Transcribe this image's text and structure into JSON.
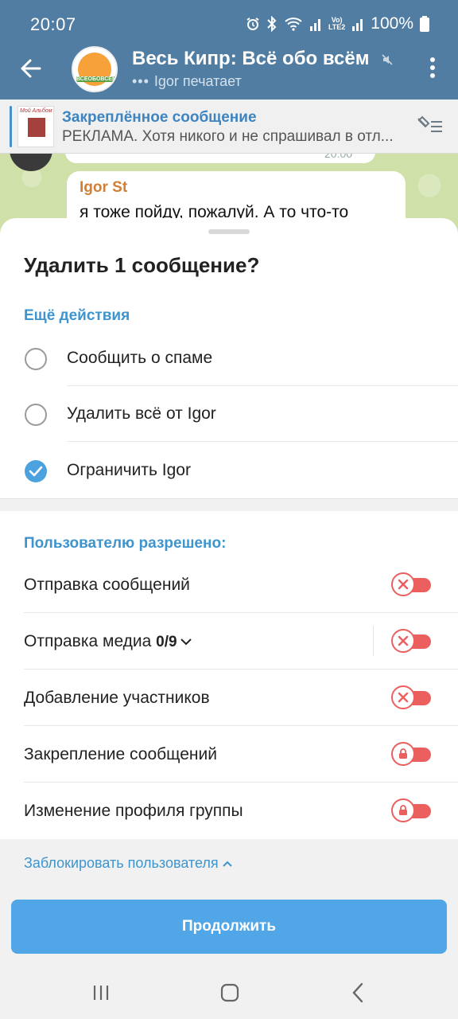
{
  "status": {
    "time": "20:07",
    "lte_top": "Vo)",
    "lte_bottom": "LTE2",
    "battery": "100%"
  },
  "chat_header": {
    "title": "Весь Кипр: Всё обо всём",
    "typing_dots": "•••",
    "subtitle": "Igor печатает",
    "avatar_tag": "ВСЕОБОВСЕМ"
  },
  "pinned": {
    "title": "Закреплённое сообщение",
    "text": "РЕКЛАМА.  Хотя никого и не спрашивал в отл...",
    "thumb_caption": "Мой Альбом"
  },
  "chat": {
    "prev_time": "20:00",
    "author": "Igor St",
    "message": "я тоже пойду, пожалуй. А то что-то"
  },
  "sheet": {
    "title": "Удалить 1 сообщение?",
    "more_actions_label": "Ещё действия",
    "options": [
      {
        "label": "Сообщить о спаме",
        "checked": false
      },
      {
        "label": "Удалить всё от Igor",
        "checked": false
      },
      {
        "label": "Ограничить Igor",
        "checked": true
      }
    ],
    "permissions_label": "Пользователю разрешено:",
    "permissions": [
      {
        "label": "Отправка сообщений",
        "icon": "x-icon",
        "enabled": false
      },
      {
        "label": "Отправка медиа",
        "count": "0/9",
        "icon": "x-icon",
        "enabled": false
      },
      {
        "label": "Добавление участников",
        "icon": "x-icon",
        "enabled": false
      },
      {
        "label": "Закрепление сообщений",
        "icon": "lock-icon",
        "enabled": false
      },
      {
        "label": "Изменение профиля группы",
        "icon": "lock-icon",
        "enabled": false
      }
    ],
    "block_label": "Заблокировать пользователя",
    "continue_label": "Продолжить"
  },
  "colors": {
    "header": "#517da2",
    "accent": "#3e95cd",
    "button": "#50a6e6",
    "toggle_off": "#ec5f5f"
  }
}
